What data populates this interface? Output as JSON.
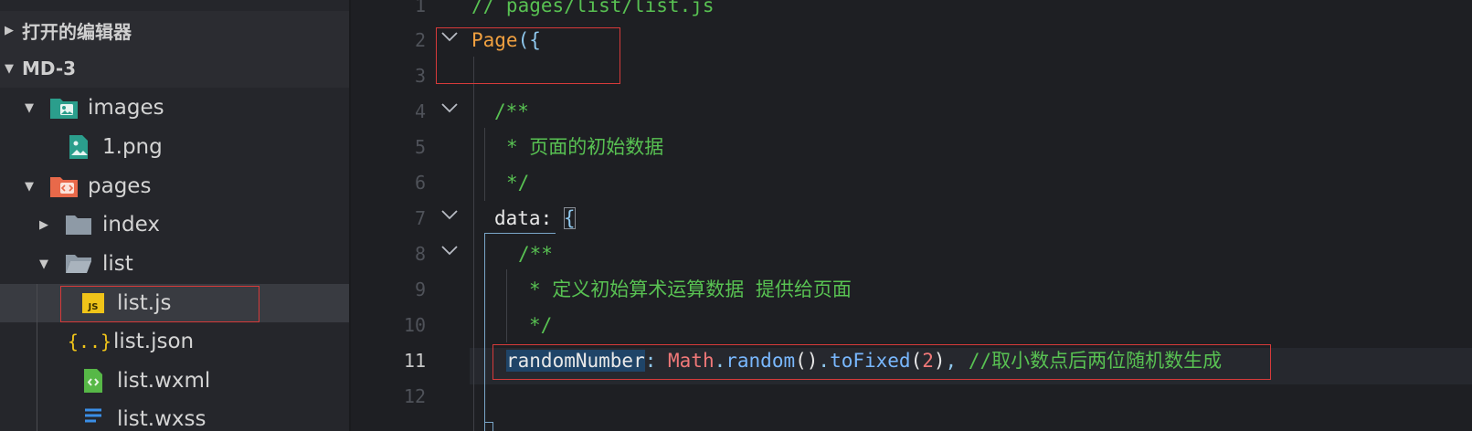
{
  "explorer": {
    "sections": [
      {
        "label": "打开的编辑器",
        "expanded": false
      },
      {
        "label": "MD-3",
        "expanded": true
      }
    ],
    "tree": [
      {
        "label": "images",
        "type": "folder-images",
        "expanded": true
      },
      {
        "label": "1.png",
        "type": "image-file"
      },
      {
        "label": "pages",
        "type": "folder-pages",
        "expanded": true
      },
      {
        "label": "index",
        "type": "folder",
        "expanded": false
      },
      {
        "label": "list",
        "type": "folder-open",
        "expanded": true
      },
      {
        "label": "list.js",
        "type": "js-file",
        "selected": true
      },
      {
        "label": "list.json",
        "type": "json-file"
      },
      {
        "label": "list.wxml",
        "type": "wxml-file"
      },
      {
        "label": "list.wxss",
        "type": "wxss-file"
      }
    ]
  },
  "editor": {
    "line_numbers": [
      "1",
      "2",
      "3",
      "4",
      "5",
      "6",
      "7",
      "8",
      "9",
      "10",
      "11",
      "12"
    ],
    "active_line": "11",
    "lines": {
      "l1": "// pages/list/list.js",
      "l2_name": "Page",
      "l2_punct": "({",
      "l4": "/**",
      "l5": "* 页面的初始数据",
      "l6": "*/",
      "l7_name": "data",
      "l7_colon": ": ",
      "l7_brace": "{",
      "l8": "/**",
      "l9": "* 定义初始算术运算数据 提供给页面",
      "l10": "*/",
      "l11_key": "randomNumber",
      "l11_colon": ": ",
      "l11_obj": "Math",
      "l11_dot1": ".",
      "l11_fn1": "random",
      "l11_paren1": "()",
      "l11_dot2": ".",
      "l11_fn2": "toFixed",
      "l11_paren2_open": "(",
      "l11_num": "2",
      "l11_paren2_close": ")",
      "l11_comma": ", ",
      "l11_comment": "//取小数点后两位随机数生成"
    }
  },
  "colors": {
    "comment": "#58c152",
    "keyword_orange": "#f0a040",
    "annotation_red": "#d63a3a",
    "selection": "#1f4468"
  }
}
